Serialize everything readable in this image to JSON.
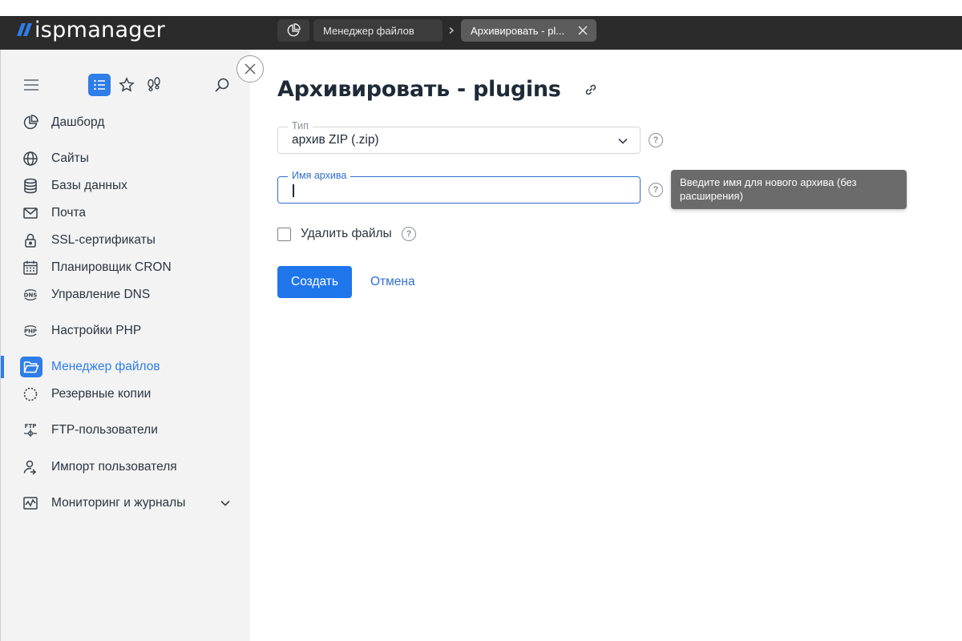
{
  "app": {
    "logo_text": "ispmanager"
  },
  "breadcrumbs": [
    {
      "label": "Менеджер файлов"
    },
    {
      "label": "Архивировать - pl..."
    }
  ],
  "sidebar": {
    "items": [
      {
        "label": "Дашборд",
        "icon": "dashboard-icon"
      },
      {
        "label": "Сайты",
        "icon": "globe-icon"
      },
      {
        "label": "Базы данных",
        "icon": "database-icon"
      },
      {
        "label": "Почта",
        "icon": "mail-icon"
      },
      {
        "label": "SSL-сертификаты",
        "icon": "lock-icon"
      },
      {
        "label": "Планировщик CRON",
        "icon": "calendar-icon"
      },
      {
        "label": "Управление DNS",
        "icon": "dns-icon"
      },
      {
        "label": "Настройки PHP",
        "icon": "php-icon"
      },
      {
        "label": "Менеджер файлов",
        "icon": "folder-icon",
        "active": true
      },
      {
        "label": "Резервные копии",
        "icon": "backup-icon"
      },
      {
        "label": "FTP-пользователи",
        "icon": "ftp-icon"
      },
      {
        "label": "Импорт пользователя",
        "icon": "user-import-icon"
      },
      {
        "label": "Мониторинг и журналы",
        "icon": "monitoring-icon",
        "expandable": true
      }
    ]
  },
  "main": {
    "title": "Архивировать - plugins",
    "type_field": {
      "label": "Тип",
      "value": "архив ZIP (.zip)"
    },
    "name_field": {
      "label": "Имя архива",
      "value": ""
    },
    "tooltip": "Введите имя для нового архива (без расширения)",
    "delete_files": {
      "label": "Удалить файлы",
      "checked": false
    },
    "create_button": "Создать",
    "cancel_button": "Отмена"
  },
  "colors": {
    "accent": "#2f7de8",
    "topbar": "#2b2b2b",
    "sidebar": "#f3f3f3",
    "tooltip": "#6b6b6b"
  }
}
